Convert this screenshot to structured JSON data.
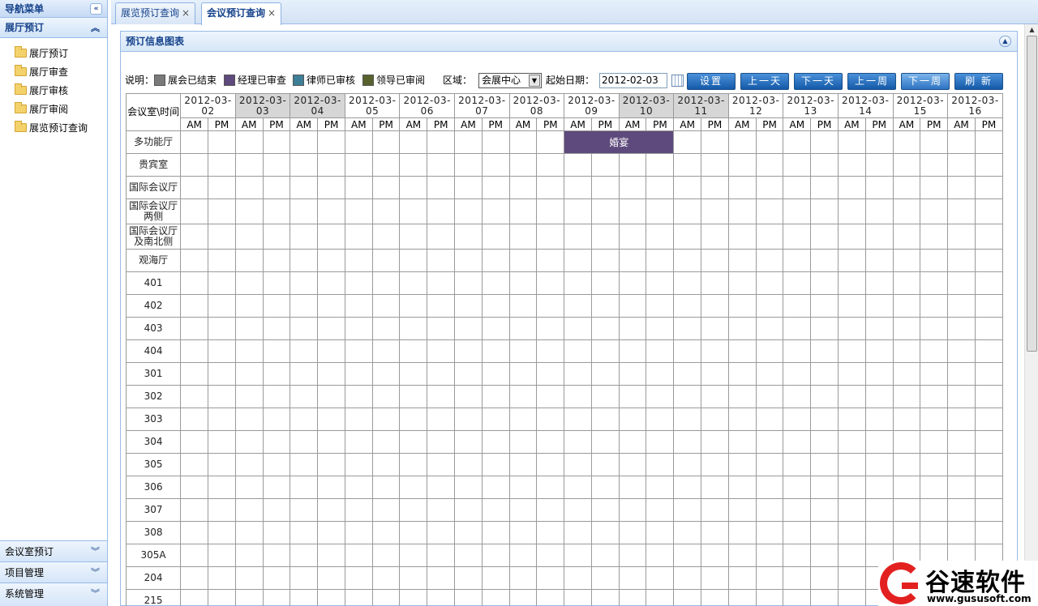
{
  "sidebar": {
    "title": "导航菜单",
    "collapse_glyph": "«",
    "active_section": "展厅预订",
    "items": [
      {
        "label": "展厅预订"
      },
      {
        "label": "展厅审查"
      },
      {
        "label": "展厅审核"
      },
      {
        "label": "展厅审阅"
      },
      {
        "label": "展览预订查询"
      }
    ],
    "bottom_sections": [
      {
        "label": "会议室预订"
      },
      {
        "label": "项目管理"
      },
      {
        "label": "系统管理"
      }
    ]
  },
  "tabs": [
    {
      "label": "展览预订查询",
      "close": "×"
    },
    {
      "label": "会议预订查询",
      "close": "×",
      "active": true
    }
  ],
  "panel": {
    "title": "预订信息图表"
  },
  "toolbar": {
    "legend_label": "说明：",
    "legend": [
      {
        "label": "展会已结束",
        "color": "#7a7a7a"
      },
      {
        "label": "经理已审查",
        "color": "#5e4a7c"
      },
      {
        "label": "律师已审核",
        "color": "#3e7f97"
      },
      {
        "label": "领导已审阅",
        "color": "#58622e"
      }
    ],
    "area_label": "区域：",
    "area_value": "会展中心",
    "start_date_label": "起始日期：",
    "start_date_value": "2012-02-03",
    "buttons": {
      "set": "设置",
      "prev_day": "上一天",
      "next_day": "下一天",
      "prev_week": "上一周",
      "next_week": "下一周",
      "refresh": "刷 新"
    }
  },
  "grid": {
    "corner_label": "会议室\\时间",
    "am": "AM",
    "pm": "PM",
    "dates": [
      {
        "label": "2012-03-02",
        "shaded": false
      },
      {
        "label": "2012-03-03",
        "shaded": true
      },
      {
        "label": "2012-03-04",
        "shaded": true
      },
      {
        "label": "2012-03-05",
        "shaded": false
      },
      {
        "label": "2012-03-06",
        "shaded": false
      },
      {
        "label": "2012-03-07",
        "shaded": false
      },
      {
        "label": "2012-03-08",
        "shaded": false
      },
      {
        "label": "2012-03-09",
        "shaded": false
      },
      {
        "label": "2012-03-10",
        "shaded": true
      },
      {
        "label": "2012-03-11",
        "shaded": true
      },
      {
        "label": "2012-03-12",
        "shaded": false
      },
      {
        "label": "2012-03-13",
        "shaded": false
      },
      {
        "label": "2012-03-14",
        "shaded": false
      },
      {
        "label": "2012-03-15",
        "shaded": false
      },
      {
        "label": "2012-03-16",
        "shaded": false
      }
    ],
    "rooms": [
      "多功能厅",
      "贵宾室",
      "国际会议厅",
      "国际会议厅两侧",
      "国际会议厅及南北侧",
      "观海厅",
      "401",
      "402",
      "403",
      "404",
      "301",
      "302",
      "303",
      "304",
      "305",
      "306",
      "307",
      "308",
      "305A",
      "204",
      "215"
    ],
    "bookings": [
      {
        "room": "多功能厅",
        "start_date": "2012-03-09",
        "start_half": "AM",
        "end_date": "2012-03-10",
        "end_half": "PM",
        "label": "婚宴",
        "status": "经理已审查"
      }
    ]
  },
  "watermark": {
    "name": "谷速软件",
    "url": "www.gususoft.com"
  }
}
